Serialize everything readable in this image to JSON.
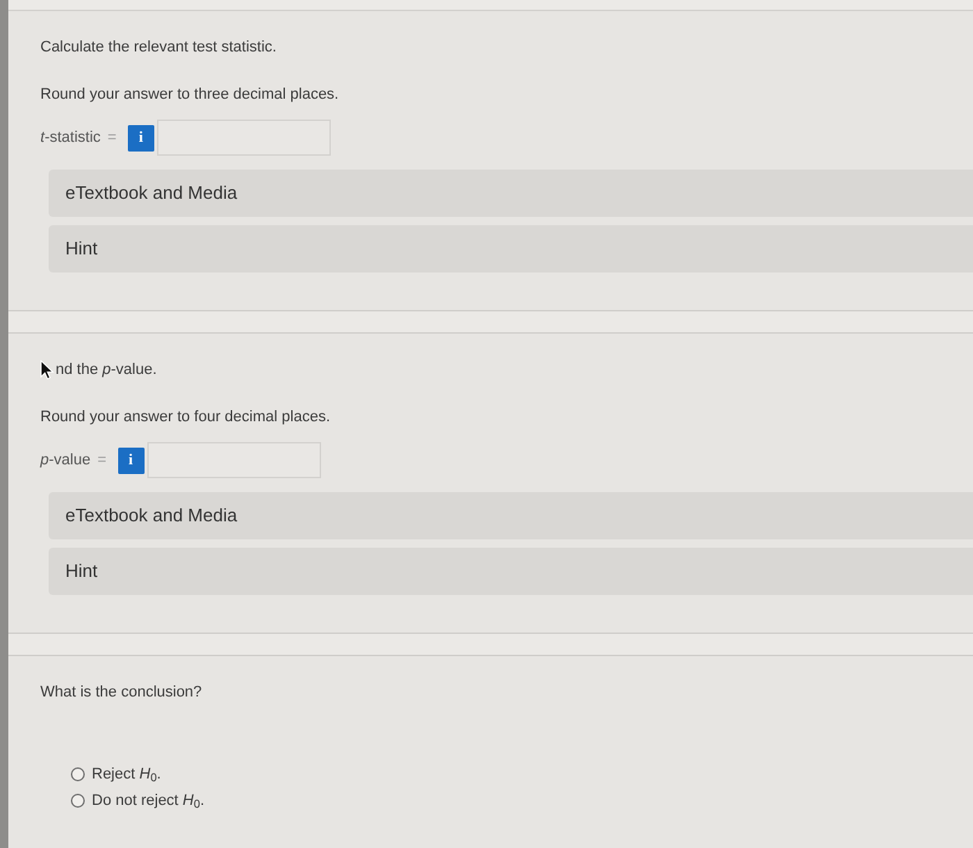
{
  "questions": [
    {
      "kind": "numeric",
      "pointer": false,
      "prompt": "Calculate the relevant test statistic.",
      "instruction": "Round your answer to three decimal places.",
      "answer": {
        "label": "*t*-statistic",
        "relation": "=",
        "info_button": "i"
      },
      "resources": [
        "eTextbook and Media",
        "Hint"
      ]
    },
    {
      "kind": "numeric",
      "pointer": true,
      "prompt": "nd the *p*-value.",
      "instruction": "Round your answer to four decimal places.",
      "answer": {
        "label": "*p*-value",
        "relation": "=",
        "info_button": "i"
      },
      "resources": [
        "eTextbook and Media",
        "Hint"
      ]
    },
    {
      "kind": "choice",
      "pointer": false,
      "prompt": "What is the conclusion?",
      "options": [
        {
          "label": "Reject *H*$_{0}$.",
          "selected": false
        },
        {
          "label": "Do not reject *H*$_{0}$.",
          "selected": false
        }
      ]
    }
  ]
}
